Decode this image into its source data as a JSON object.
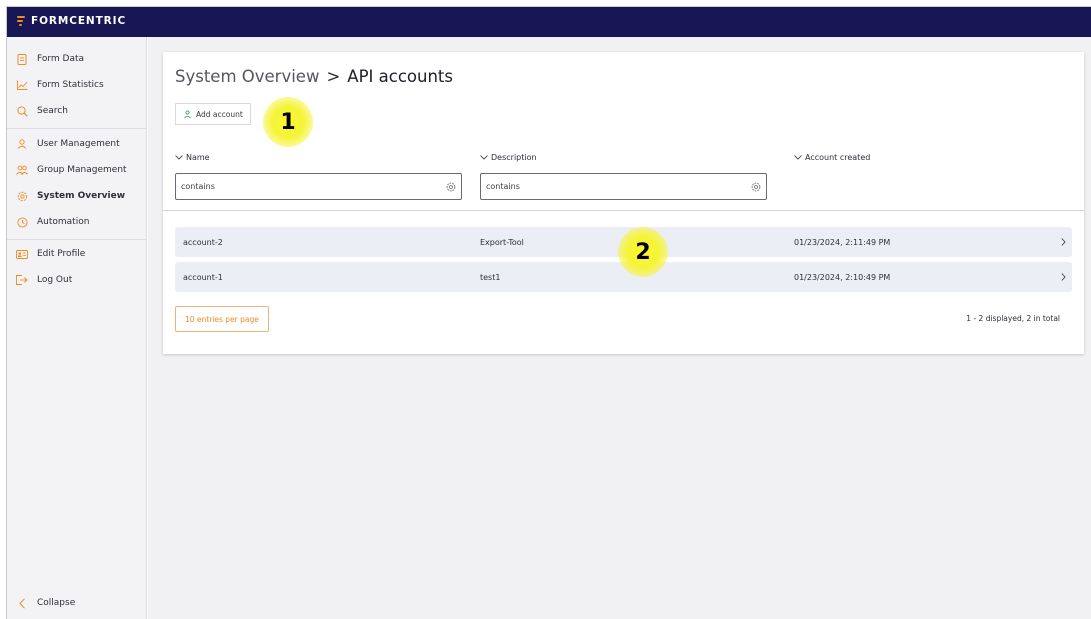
{
  "app": {
    "logo_text": "FORMCENTRIC"
  },
  "sidebar": {
    "items": [
      {
        "label": "Form Data",
        "icon": "document-icon"
      },
      {
        "label": "Form Statistics",
        "icon": "line-chart-icon"
      },
      {
        "label": "Search",
        "icon": "search-icon"
      },
      {
        "label": "User Management",
        "icon": "user-icon"
      },
      {
        "label": "Group Management",
        "icon": "users-icon"
      },
      {
        "label": "System Overview",
        "icon": "gear-icon",
        "active": true
      },
      {
        "label": "Automation",
        "icon": "clock-icon"
      },
      {
        "label": "Edit Profile",
        "icon": "id-card-icon"
      },
      {
        "label": "Log Out",
        "icon": "logout-icon"
      }
    ],
    "collapse_label": "Collapse"
  },
  "page": {
    "breadcrumb_parent": "System Overview",
    "breadcrumb_separator": ">",
    "breadcrumb_current": "API accounts",
    "add_account_label": "Add account"
  },
  "table": {
    "columns": [
      {
        "label": "Name",
        "filter_placeholder": "contains"
      },
      {
        "label": "Description",
        "filter_placeholder": "contains"
      },
      {
        "label": "Account created"
      }
    ],
    "rows": [
      {
        "name": "account-2",
        "description": "Export-Tool",
        "created": "01/23/2024, 2:11:49 PM"
      },
      {
        "name": "account-1",
        "description": "test1",
        "created": "01/23/2024, 2:10:49 PM"
      }
    ]
  },
  "pagination": {
    "per_page_label": "10 entries per page",
    "total_label": "1 - 2 displayed, 2 in total"
  },
  "annotations": {
    "marker_1": "1",
    "marker_2": "2"
  },
  "colors": {
    "topbar": "#191655",
    "accent": "#f08a24",
    "marker": "#f6f43a"
  }
}
